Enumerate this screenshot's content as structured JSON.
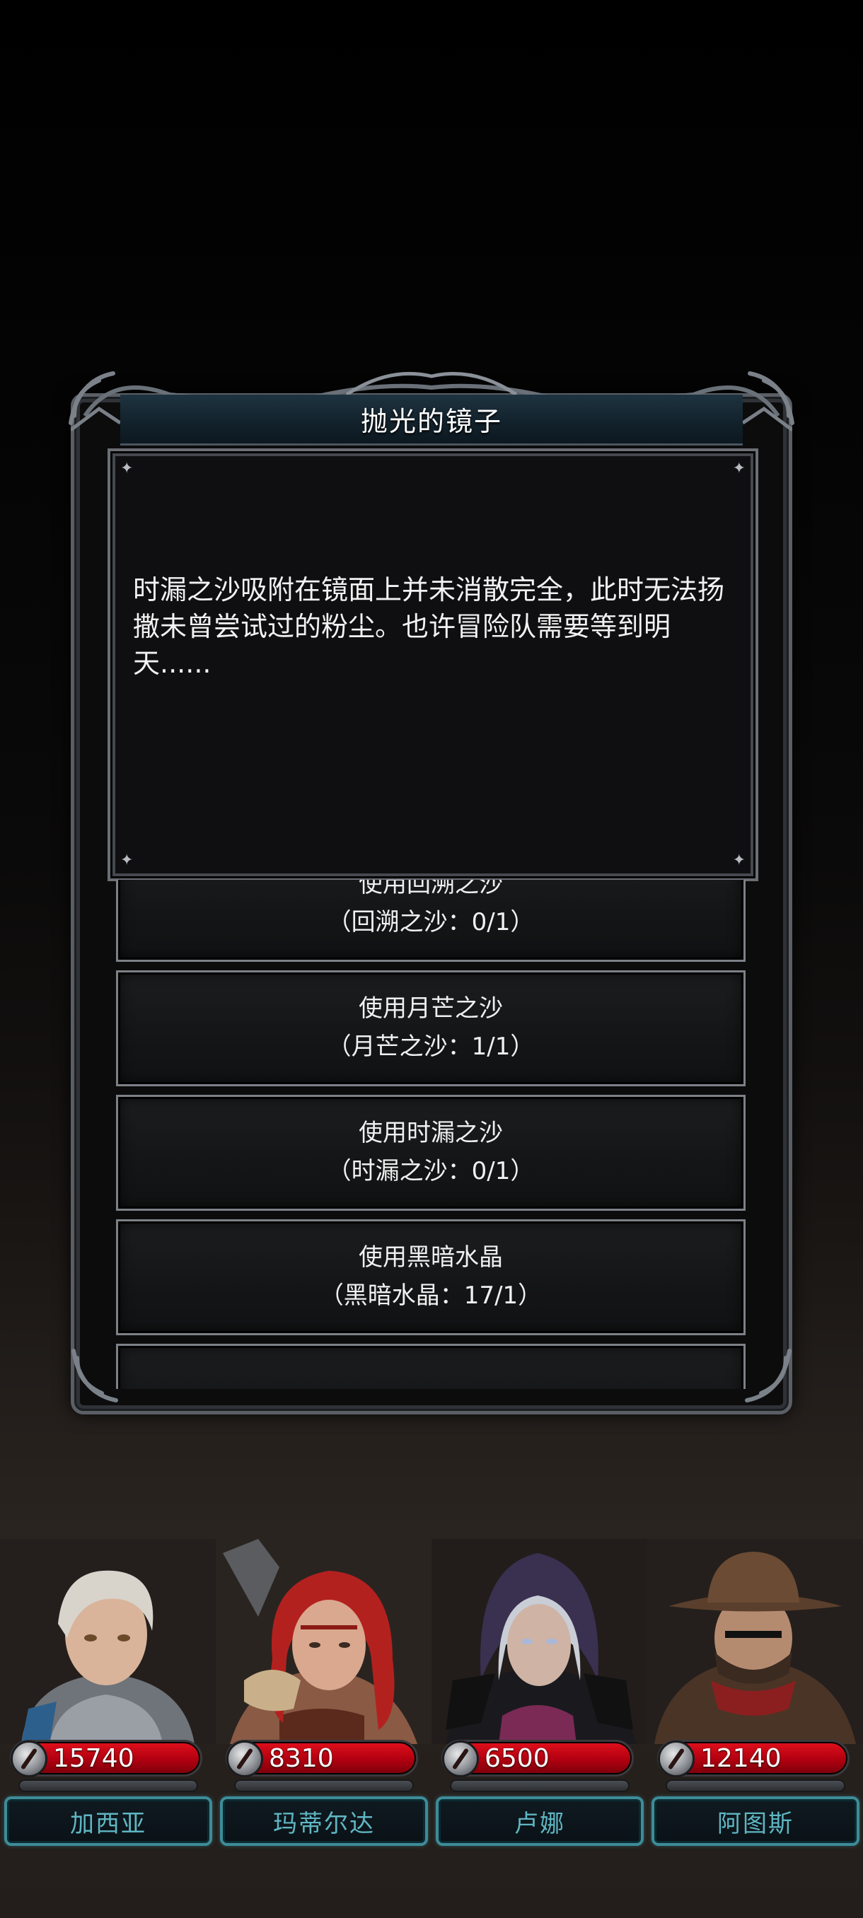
{
  "dialog": {
    "title": "抛光的镜子",
    "narrative": "时漏之沙吸附在镜面上并未消散完全，此时无法扬撒未曾尝试过的粉尘。也许冒险队需要等到明天......"
  },
  "options": [
    {
      "label": "使用回溯之沙",
      "detail": "（回溯之沙：0/1）"
    },
    {
      "label": "使用月芒之沙",
      "detail": "（月芒之沙：1/1）"
    },
    {
      "label": "使用时漏之沙",
      "detail": "（时漏之沙：0/1）"
    },
    {
      "label": "使用黑暗水晶",
      "detail": "（黑暗水晶：17/1）"
    }
  ],
  "party": [
    {
      "name": "加西亚",
      "hp": "15740",
      "portrait": "young-knight-portrait"
    },
    {
      "name": "玛蒂尔达",
      "hp": "8310",
      "portrait": "red-haired-warrior-portrait"
    },
    {
      "name": "卢娜",
      "hp": "6500",
      "portrait": "hooded-mage-portrait"
    },
    {
      "name": "阿图斯",
      "hp": "12140",
      "portrait": "cowboy-gunslinger-portrait"
    }
  ],
  "colors": {
    "hp_bar": "#c8101c",
    "name_plate_border": "#3d8c98",
    "name_text": "#5fb6c3",
    "title_bar": "#1e3340"
  }
}
